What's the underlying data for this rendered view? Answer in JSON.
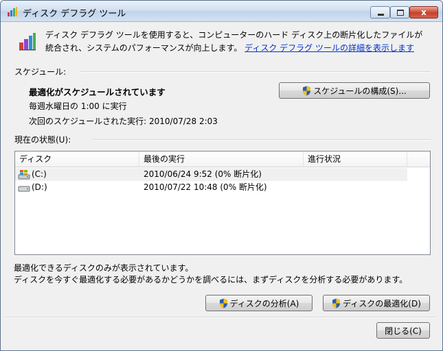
{
  "window": {
    "title": "ディスク デフラグ ツール",
    "close_glyph": "x"
  },
  "description": {
    "text": "ディスク デフラグ ツールを使用すると、コンピューターのハード ディスク上の断片化したファイルが統合され、システムのパフォーマンスが向上します。",
    "link_text": "ディスク デフラグ ツールの詳細を表示します"
  },
  "schedule": {
    "section_label": "スケジュール:",
    "status": "最適化がスケジュールされています",
    "frequency": "毎週水曜日の 1:00 に実行",
    "next_run": "次回のスケジュールされた実行: 2010/07/28 2:03",
    "configure_button": "スケジュールの構成(S)..."
  },
  "current_state": {
    "section_label": "現在の状態(U):",
    "columns": [
      "ディスク",
      "最後の実行",
      "進行状況"
    ],
    "rows": [
      {
        "disk": "(C:)",
        "last_run": "2010/06/24 9:52 (0% 断片化)",
        "progress": "",
        "icon": "system-drive-icon"
      },
      {
        "disk": "(D:)",
        "last_run": "2010/07/22 10:48 (0% 断片化)",
        "progress": "",
        "icon": "hard-drive-icon"
      }
    ]
  },
  "notes": {
    "line1": "最適化できるディスクのみが表示されています。",
    "line2": "ディスクを今すぐ最適化する必要があるかどうかを調べるには、まずディスクを分析する必要があります。"
  },
  "actions": {
    "analyze_button": "ディスクの分析(A)",
    "defrag_button": "ディスクの最適化(D)",
    "close_button": "閉じる(C)"
  },
  "colors": {
    "link": "#0033cc",
    "shield_blue": "#2a5db0",
    "shield_yellow": "#f2c21a"
  }
}
